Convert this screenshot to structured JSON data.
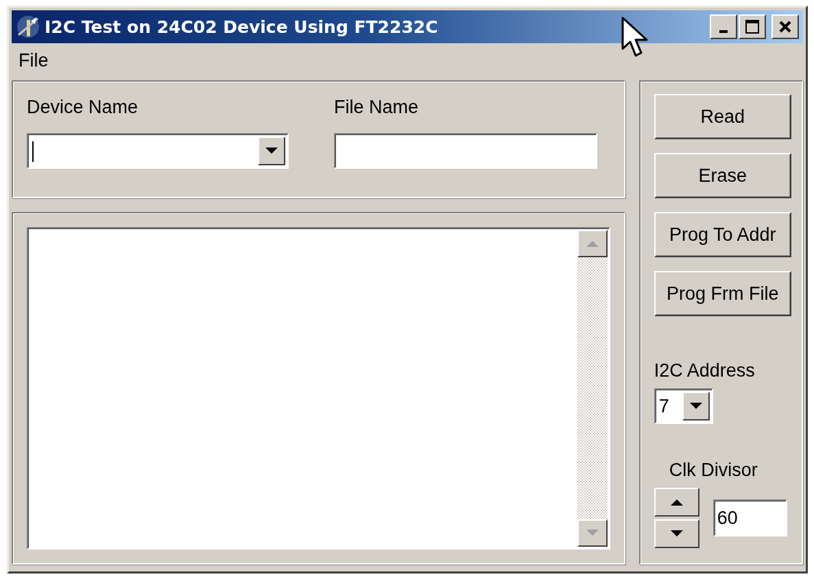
{
  "window": {
    "title": "I2C Test on 24C02 Device Using FT2232C"
  },
  "menu": [
    "File"
  ],
  "device_name": {
    "label": "Device Name"
  },
  "file_name": {
    "label": "File Name"
  },
  "buttons": [
    "Read",
    "Erase",
    "Prog To Addr",
    "Prog Frm File"
  ],
  "i2c_address": {
    "label": "I2C Address",
    "value": "7"
  },
  "clk_divisor": {
    "label": "Clk Divisor",
    "value": "60"
  }
}
